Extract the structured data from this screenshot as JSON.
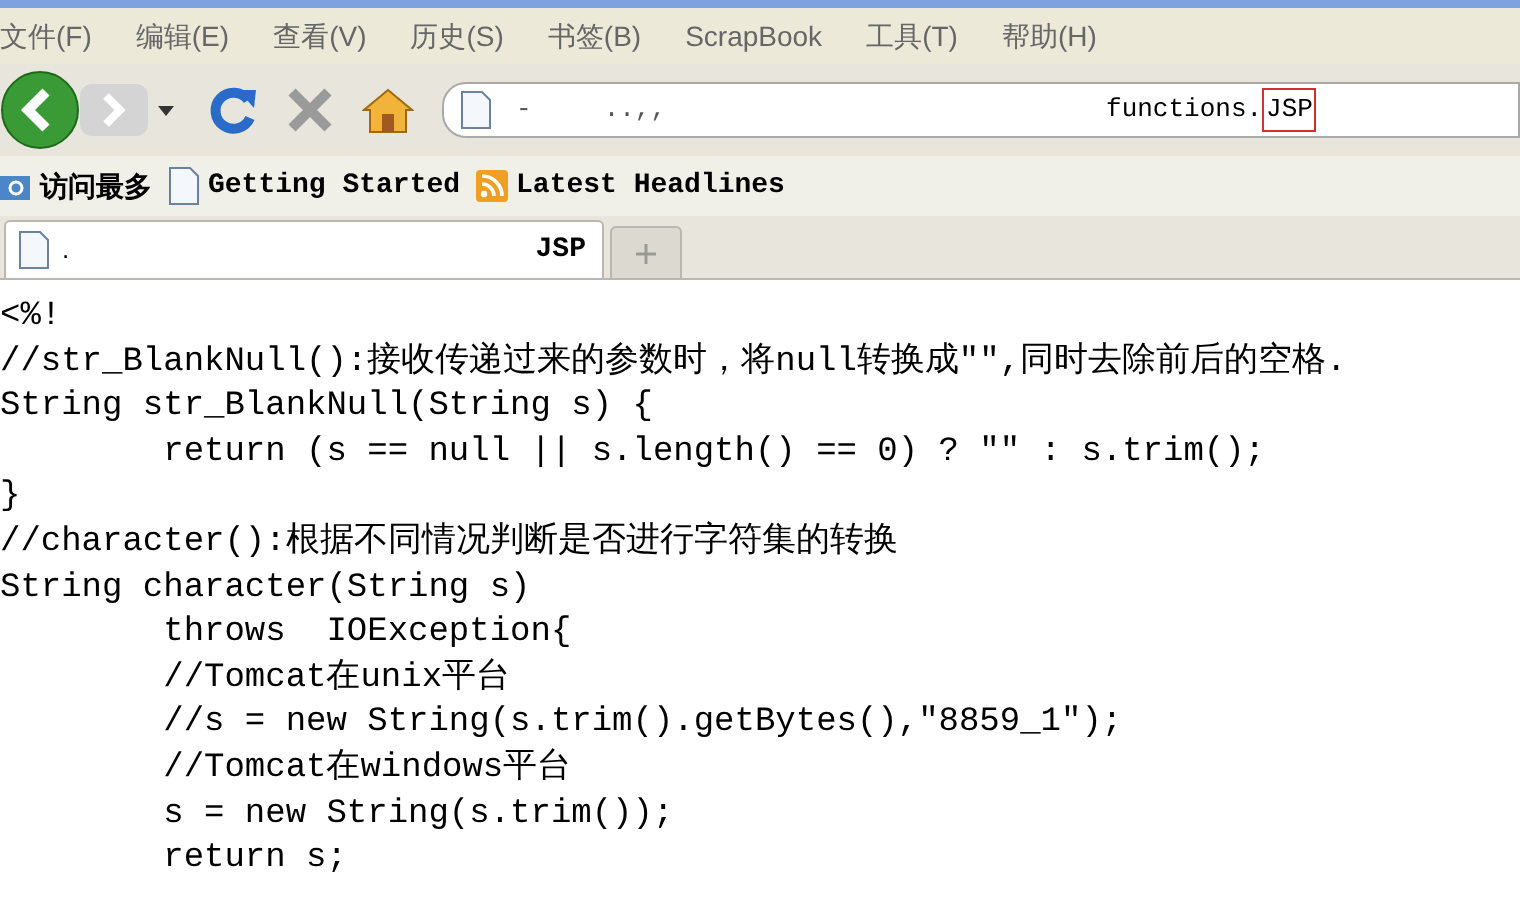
{
  "menu": [
    "文件(F)",
    "编辑(E)",
    "查看(V)",
    "历史(S)",
    "书签(B)",
    "ScrapBook",
    "工具(T)",
    "帮助(H)"
  ],
  "address_bar": {
    "fragments": [
      "-",
      "..,,"
    ],
    "file_name": "functions.",
    "extension": "JSP",
    "extension_highlighted": true
  },
  "bookmarks": [
    {
      "kind": "folder",
      "label": "访问最多"
    },
    {
      "kind": "page",
      "label": "Getting Started"
    },
    {
      "kind": "feed",
      "label": "Latest Headlines"
    }
  ],
  "tabs": [
    {
      "title_prefix": ".",
      "title": "JSP",
      "selected": true
    }
  ],
  "code_lines": [
    "<%!",
    "//str_BlankNull():接收传递过来的参数时，将null转换成\"\",同时去除前后的空格.",
    "String str_BlankNull(String s) {",
    "        return (s == null || s.length() == 0) ? \"\" : s.trim();",
    "}",
    "//character():根据不同情况判断是否进行字符集的转换",
    "String character(String s)",
    "        throws  IOException{",
    "        //Tomcat在unix平台",
    "        //s = new String(s.trim().getBytes(),\"8859_1\");",
    "        //Tomcat在windows平台",
    "        s = new String(s.trim());",
    "        return s;"
  ]
}
